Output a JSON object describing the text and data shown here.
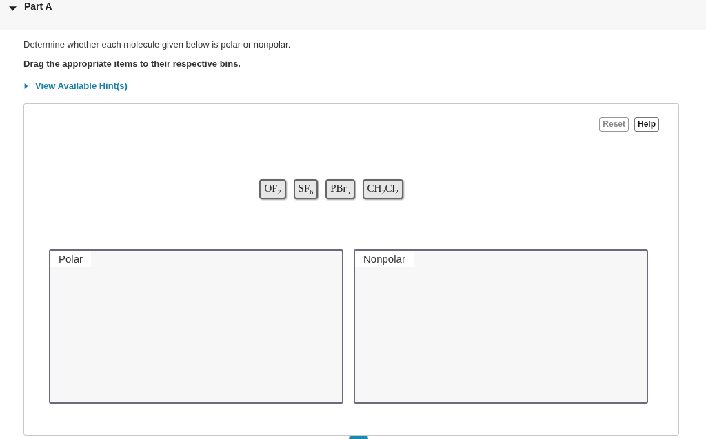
{
  "part": {
    "title": "Part A",
    "expanded": true
  },
  "instructions": "Determine whether each molecule given below is polar or nonpolar.",
  "task": "Drag the appropriate items to their respective bins.",
  "hint_link": {
    "label": "View Available Hint(s)",
    "expanded": false
  },
  "toolbar_buttons": [
    {
      "label": "Reset",
      "disabled": true
    },
    {
      "label": "Help",
      "disabled": false
    }
  ],
  "items": [
    {
      "label": "OF$_{2}$"
    },
    {
      "label": "SF$_{6}$"
    },
    {
      "label": "PBr$_{5}$"
    },
    {
      "label": "CH$_{2}$Cl$_{2}$"
    }
  ],
  "bins": [
    {
      "label": "Polar"
    },
    {
      "label": "Nonpolar"
    }
  ]
}
